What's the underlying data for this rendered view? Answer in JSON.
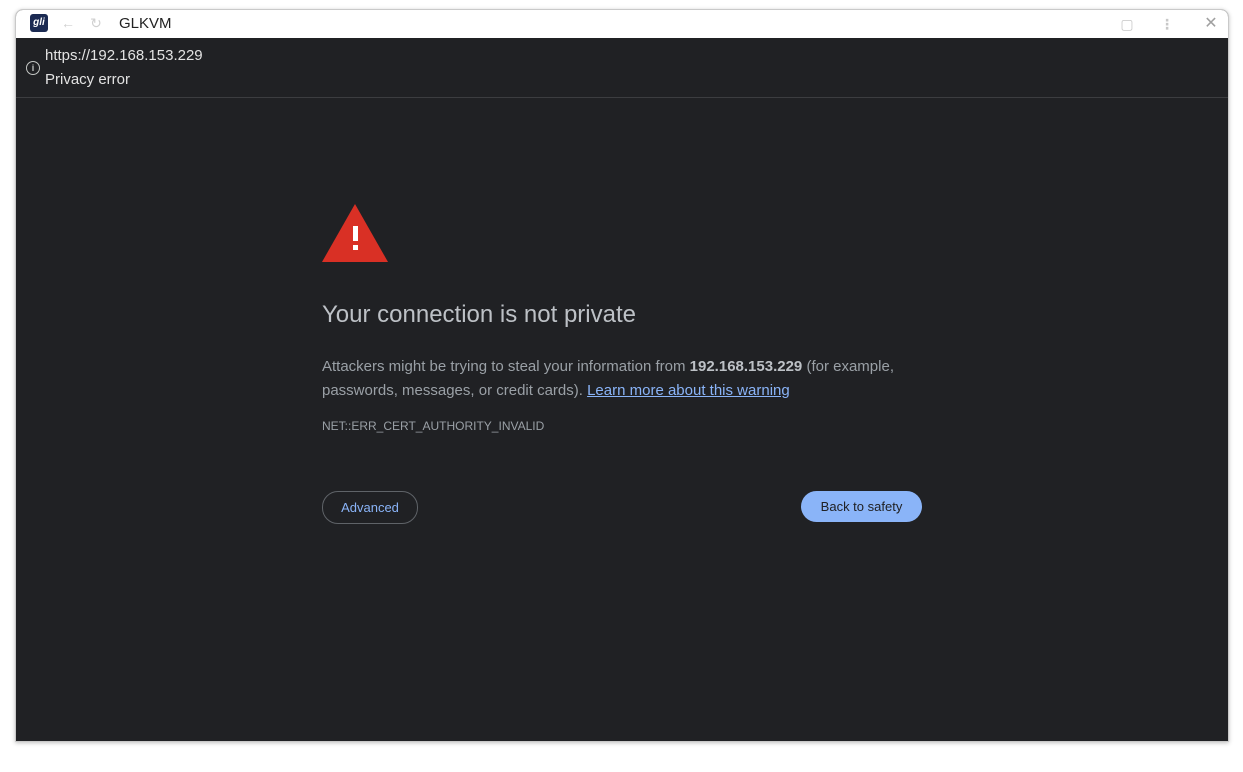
{
  "window": {
    "app_icon_text": "gli",
    "title": "GLKVM"
  },
  "titlebar_icons": {
    "back": "arrow-left-icon",
    "reload": "reload-icon",
    "extension": "extension-icon",
    "menu": "more-vert-icon",
    "close": "close-icon"
  },
  "urlbar": {
    "info_icon": "info-icon",
    "url": "https://192.168.153.229",
    "page_title": "Privacy error"
  },
  "error_page": {
    "icon": "warning-triangle-icon",
    "heading": "Your connection is not private",
    "desc_prefix": "Attackers might be trying to steal your information from ",
    "host": "192.168.153.229",
    "desc_suffix": " (for example, passwords, messages, or credit cards). ",
    "learn_more": "Learn more about this warning",
    "error_code": "NET::ERR_CERT_AUTHORITY_INVALID",
    "advanced_label": "Advanced",
    "back_label": "Back to safety"
  },
  "colors": {
    "background": "#202124",
    "accent": "#8ab4f8",
    "warning": "#d93025"
  }
}
